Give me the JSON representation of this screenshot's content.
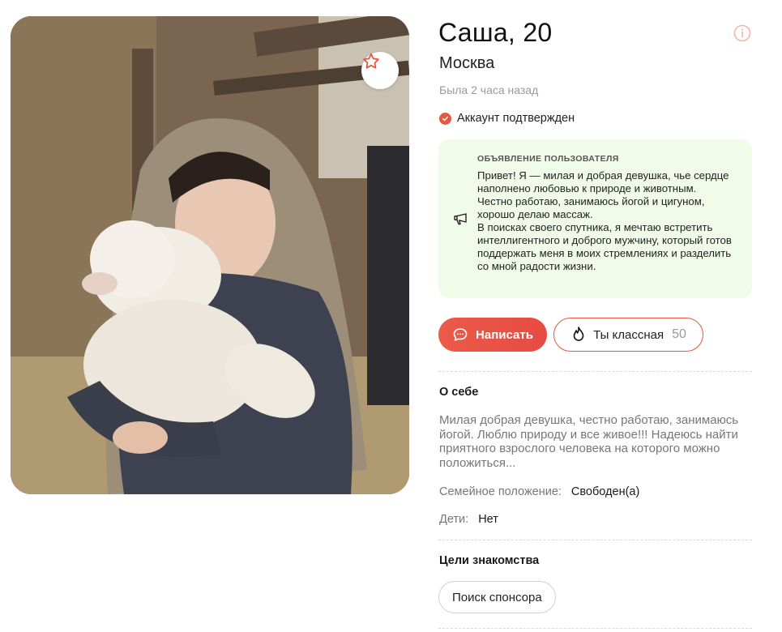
{
  "profile": {
    "name_age": "Саша, 20",
    "city": "Москва",
    "last_seen": "Была 2 часа назад",
    "verified_label": "Аккаунт подтвержден"
  },
  "ad": {
    "title": "Объявление пользователя",
    "text": "Привет! Я — милая и добрая девушка, чье сердце наполнено любовью к природе и животным.\nЧестно работаю, занимаюсь йогой и цигуном, хорошо делаю массаж.\nВ поисках своего спутника, я мечтаю встретить интеллигентного и доброго мужчину, который готов поддержать меня в моих стремлениях и разделить со мной радости жизни."
  },
  "actions": {
    "write_label": "Написать",
    "like_label": "Ты классная",
    "like_count": "50"
  },
  "about": {
    "title": "О себе",
    "text": "Милая добрая девушка, честно работаю, занимаюсь йогой. Люблю природу и все живое!!! Надеюсь найти приятного взрослого человека на которого можно положиться..."
  },
  "details": {
    "marital_label": "Семейное положение:",
    "marital_value": "Свободен(а)",
    "kids_label": "Дети:",
    "kids_value": "Нет"
  },
  "goals": {
    "title": "Цели знакомства",
    "items": [
      "Поиск спонсора"
    ]
  },
  "colors": {
    "accent": "#e8563f",
    "ad_background": "#f1fbe9",
    "muted_text": "#777777"
  },
  "icons": {
    "favorite": "star-outline-icon",
    "info": "info-circle-icon",
    "verified": "check-circle-icon",
    "ad": "megaphone-icon",
    "write": "chat-bubble-icon",
    "like": "flame-icon"
  }
}
